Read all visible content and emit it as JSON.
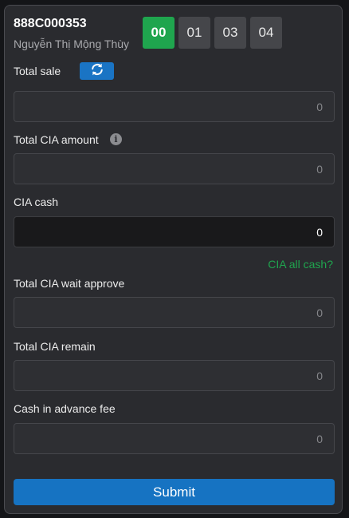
{
  "account": {
    "id": "888C000353",
    "name": "Nguyễn Thị Mộng Thùy"
  },
  "time_tabs": [
    {
      "label": "00",
      "active": true
    },
    {
      "label": "01",
      "active": false
    },
    {
      "label": "03",
      "active": false
    },
    {
      "label": "04",
      "active": false
    }
  ],
  "total_sale": {
    "label": "Total sale",
    "value": "0",
    "refresh_icon": "refresh-icon"
  },
  "total_cia_amount": {
    "label": "Total CIA amount",
    "info_icon": "info-icon",
    "info_glyph": "i",
    "value": "0"
  },
  "cia_cash": {
    "label": "CIA cash",
    "value": "0"
  },
  "cia_all_cash_link": "CIA all cash?",
  "total_cia_wait_approve": {
    "label": "Total CIA wait approve",
    "value": "0"
  },
  "total_cia_remain": {
    "label": "Total CIA remain",
    "value": "0"
  },
  "cash_in_advance_fee": {
    "label": "Cash in advance fee",
    "value": "0"
  },
  "submit_label": "Submit",
  "colors": {
    "panel_bg": "#2a2b2f",
    "accent_green": "#1fa54e",
    "accent_blue": "#1673c2"
  }
}
